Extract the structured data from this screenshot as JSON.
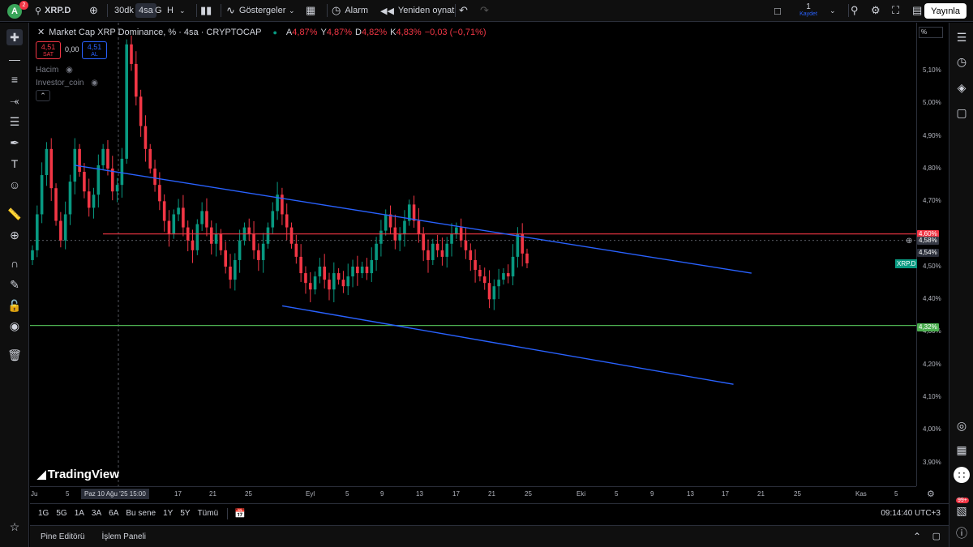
{
  "toolbar": {
    "avatar_letter": "A",
    "avatar_badge": "2",
    "symbol": "XRP.D",
    "intervals": [
      "30dk",
      "4sa",
      "G",
      "H"
    ],
    "active_interval": "4sa",
    "indicators_label": "Göstergeler",
    "alarm_label": "Alarm",
    "replay_label": "Yeniden oynat",
    "layout_count": "1",
    "layout_save": "Kaydet",
    "publish_label": "Yayınla"
  },
  "legend": {
    "title": "Market Cap XRP Dominance, % · 4sa · CRYPTOCAP",
    "o_label": "A",
    "o": "4,87%",
    "h_label": "Y",
    "h": "4,87%",
    "l_label": "D",
    "l": "4,82%",
    "c_label": "K",
    "c": "4,83%",
    "change": "−0,03 (−0,71%)",
    "sell_price": "4,51",
    "sell_label": "SAT",
    "spread": "0,00",
    "buy_price": "4,51",
    "buy_label": "AL",
    "indicator_1": "Hacim",
    "indicator_2": "Investor_coin"
  },
  "brand": "TradingView",
  "price_scale": {
    "unit_button": "%",
    "ticks": [
      "5,10%",
      "5,00%",
      "4,90%",
      "4,80%",
      "4,70%",
      "4,50%",
      "4,40%",
      "4,30%",
      "4,20%",
      "4,10%",
      "4,00%",
      "3,90%"
    ],
    "badge_resistance": "4,60%",
    "badge_cursor": "4,58%",
    "badge_last": "4,54%",
    "badge_support": "4,32%",
    "symbol_tag": "XRP.D"
  },
  "time_axis": {
    "ticks": [
      "Ju",
      "5",
      "17",
      "21",
      "25",
      "Eyl",
      "5",
      "9",
      "13",
      "17",
      "21",
      "25",
      "Eki",
      "5",
      "9",
      "13",
      "17",
      "21",
      "25",
      "Kas",
      "5"
    ],
    "cursor_label": "Paz 10 Ağu '25   15:00"
  },
  "ranges": [
    "1G",
    "5G",
    "1A",
    "3A",
    "6A",
    "Bu sene",
    "1Y",
    "5Y",
    "Tümü"
  ],
  "clock": "09:14:40 UTC+3",
  "bottom_panel": {
    "pine": "Pine Editörü",
    "trading": "İşlem Paneli"
  },
  "notifications_badge": "99+",
  "colors": {
    "up": "#089981",
    "down": "#f23645",
    "trendline": "#2962ff",
    "resistance": "#f23645",
    "support": "#4caf50"
  },
  "chart_data": {
    "type": "candlestick",
    "title": "Market Cap XRP Dominance, % · 4sa · CRYPTOCAP",
    "ylim": [
      3.86,
      5.2
    ],
    "x_range": [
      "2025-07-31",
      "2025-11-06"
    ],
    "closes": [
      4.55,
      4.66,
      4.78,
      4.86,
      4.74,
      4.64,
      4.58,
      4.66,
      4.76,
      4.86,
      4.79,
      4.73,
      4.68,
      4.72,
      4.81,
      4.86,
      4.8,
      4.73,
      4.75,
      4.83,
      5.18,
      5.12,
      5.02,
      4.93,
      4.86,
      4.8,
      4.75,
      4.7,
      4.64,
      4.6,
      4.66,
      4.68,
      4.62,
      4.58,
      4.55,
      4.63,
      4.67,
      4.62,
      4.57,
      4.6,
      4.55,
      4.5,
      4.46,
      4.52,
      4.58,
      4.62,
      4.6,
      4.55,
      4.52,
      4.57,
      4.62,
      4.67,
      4.72,
      4.66,
      4.62,
      4.57,
      4.53,
      4.48,
      4.45,
      4.43,
      4.47,
      4.5,
      4.46,
      4.43,
      4.48,
      4.46,
      4.44,
      4.47,
      4.5,
      4.48,
      4.5,
      4.48,
      4.52,
      4.57,
      4.61,
      4.66,
      4.62,
      4.58,
      4.6,
      4.64,
      4.69,
      4.64,
      4.6,
      4.55,
      4.52,
      4.57,
      4.55,
      4.53,
      4.57,
      4.6,
      4.62,
      4.58,
      4.55,
      4.52,
      4.49,
      4.47,
      4.45,
      4.4,
      4.44,
      4.46,
      4.48,
      4.47,
      4.53,
      4.6,
      4.54,
      4.51
    ],
    "resistance_level": 4.6,
    "support_level": 4.32,
    "upper_trendline": [
      {
        "x": "2025-08-06",
        "y": 4.81
      },
      {
        "x": "2025-10-20",
        "y": 4.48
      }
    ],
    "lower_trendline": [
      {
        "x": "2025-08-29",
        "y": 4.38
      },
      {
        "x": "2025-10-18",
        "y": 4.14
      }
    ]
  }
}
